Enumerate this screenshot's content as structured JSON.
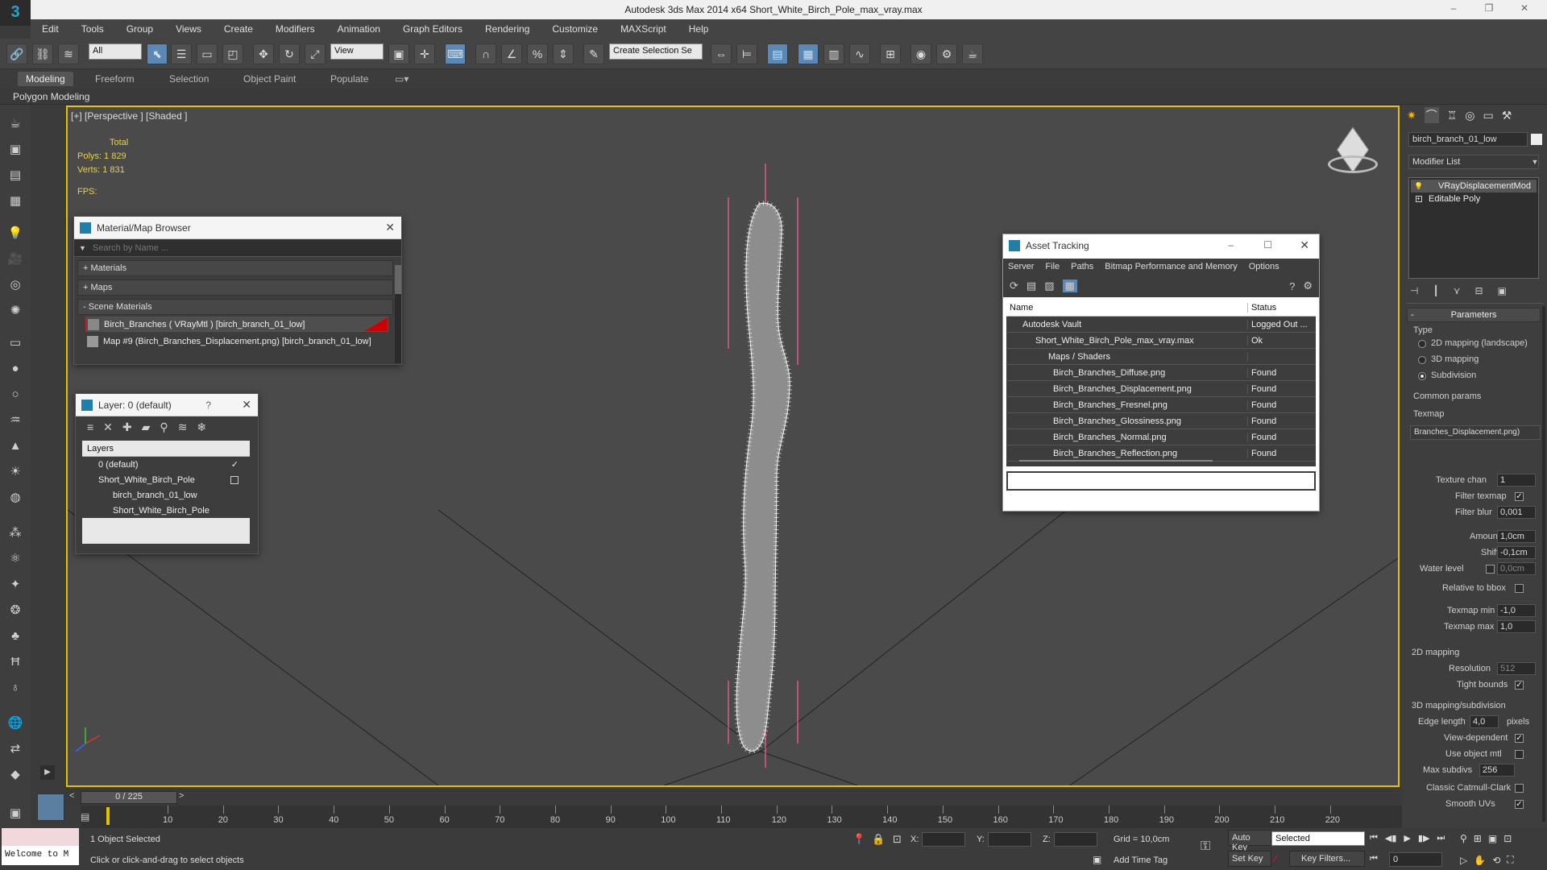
{
  "app": {
    "title": "Autodesk 3ds Max  2014 x64     Short_White_Birch_Pole_max_vray.max",
    "logo": "3",
    "window_controls": [
      "–",
      "❐",
      "✕"
    ]
  },
  "menu": [
    "Edit",
    "Tools",
    "Group",
    "Views",
    "Create",
    "Modifiers",
    "Animation",
    "Graph Editors",
    "Rendering",
    "Customize",
    "MAXScript",
    "Help"
  ],
  "toolbar": {
    "selection_filter": "All",
    "ref_coord": "View",
    "selection_set": "Create Selection Se"
  },
  "ribbon": {
    "tabs": [
      "Modeling",
      "Freeform",
      "Selection",
      "Object Paint",
      "Populate"
    ],
    "active": "Modeling",
    "sub": "Polygon Modeling"
  },
  "viewport": {
    "label": "[+] [Perspective ] [Shaded ]",
    "stats_header": "Total",
    "polys_label": "Polys:",
    "polys_value": "1 829",
    "verts_label": "Verts:",
    "verts_value": "1 831",
    "fps_label": "FPS:"
  },
  "material_browser": {
    "title": "Material/Map Browser",
    "search_placeholder": "Search by Name ...",
    "sections": [
      "+ Materials",
      "+ Maps",
      "- Scene Materials"
    ],
    "items": [
      "Birch_Branches  ( VRayMtl ) [birch_branch_01_low]",
      "Map #9 (Birch_Branches_Displacement.png) [birch_branch_01_low]"
    ]
  },
  "layer_dialog": {
    "title": "Layer: 0 (default)",
    "help": "?",
    "column": "Layers",
    "rows": [
      "0 (default)",
      "Short_White_Birch_Pole",
      "birch_branch_01_low",
      "Short_White_Birch_Pole"
    ]
  },
  "asset_tracking": {
    "title": "Asset Tracking",
    "menu": [
      "Server",
      "File",
      "Paths",
      "Bitmap Performance and Memory",
      "Options"
    ],
    "col_name": "Name",
    "col_status": "Status",
    "rows": [
      {
        "name": "Autodesk Vault",
        "status": "Logged Out ..."
      },
      {
        "name": "Short_White_Birch_Pole_max_vray.max",
        "status": "Ok"
      },
      {
        "name": "Maps / Shaders",
        "status": ""
      },
      {
        "name": "Birch_Branches_Diffuse.png",
        "status": "Found"
      },
      {
        "name": "Birch_Branches_Displacement.png",
        "status": "Found"
      },
      {
        "name": "Birch_Branches_Fresnel.png",
        "status": "Found"
      },
      {
        "name": "Birch_Branches_Glossiness.png",
        "status": "Found"
      },
      {
        "name": "Birch_Branches_Normal.png",
        "status": "Found"
      },
      {
        "name": "Birch_Branches_Reflection.png",
        "status": "Found"
      }
    ]
  },
  "command_panel": {
    "object_name": "birch_branch_01_low",
    "modifier_list": "Modifier List",
    "stack": [
      "VRayDisplacementMod",
      "Editable Poly"
    ],
    "rollout": "Parameters",
    "type_label": "Type",
    "types": [
      "2D mapping (landscape)",
      "3D mapping",
      "Subdivision"
    ],
    "selected_type": "Subdivision",
    "common_params": "Common params",
    "texmap_label": "Texmap",
    "texmap_value": "Branches_Displacement.png)",
    "texture_chan_label": "Texture chan",
    "texture_chan": "1",
    "filter_texmap": "Filter texmap",
    "filter_blur_label": "Filter blur",
    "filter_blur": "0,001",
    "amount_label": "Amount",
    "amount": "1,0cm",
    "shift_label": "Shift",
    "shift": "-0,1cm",
    "water_level_label": "Water level",
    "water_level": "0,0cm",
    "relative_bbox": "Relative to bbox",
    "texmap_min_label": "Texmap min",
    "texmap_min": "-1,0",
    "texmap_max_label": "Texmap max",
    "texmap_max": "1,0",
    "mapping_2d": "2D mapping",
    "resolution_label": "Resolution",
    "resolution": "512",
    "tight_bounds": "Tight bounds",
    "mapping_3d": "3D mapping/subdivision",
    "edge_length_label": "Edge length",
    "edge_length": "4,0",
    "pixels": "pixels",
    "view_dependent": "View-dependent",
    "use_object_mtl": "Use object mtl",
    "max_subdivs_label": "Max subdivs",
    "max_subdivs": "256",
    "classic_catmull": "Classic Catmull-Clark",
    "smooth_uvs": "Smooth UVs"
  },
  "timeline": {
    "frame": "0 / 225",
    "ticks": [
      "10",
      "20",
      "30",
      "40",
      "50",
      "60",
      "70",
      "80",
      "90",
      "100",
      "110",
      "120",
      "130",
      "140",
      "150",
      "160",
      "170",
      "180",
      "190",
      "200",
      "210",
      "220"
    ]
  },
  "status": {
    "script_listener": "Welcome to M",
    "selected": "1 Object Selected",
    "prompt": "Click or click-and-drag to select objects",
    "x_label": "X:",
    "y_label": "Y:",
    "z_label": "Z:",
    "grid": "Grid = 10,0cm",
    "add_time_tag": "Add Time Tag",
    "auto_key": "Auto Key",
    "set_key": "Set Key",
    "key_mode": "Selected",
    "key_filters": "Key Filters...",
    "current_frame": "0"
  }
}
